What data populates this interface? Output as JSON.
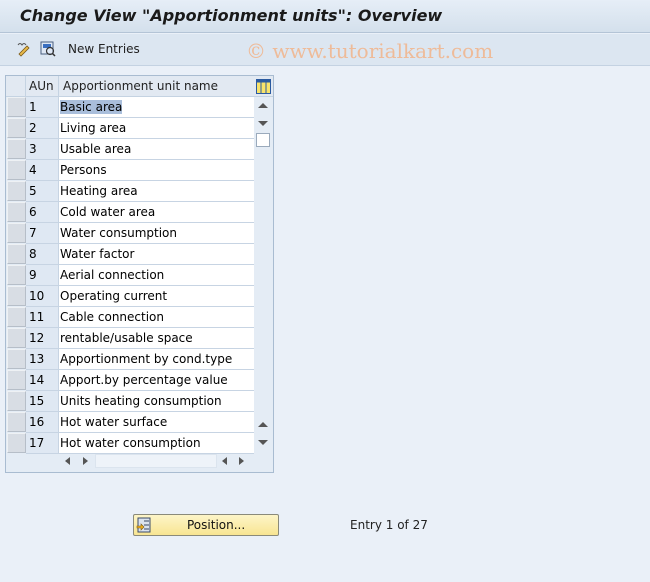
{
  "title": "Change View \"Apportionment units\": Overview",
  "toolbar": {
    "icons": [
      "display-change-icon",
      "select-all-icon"
    ],
    "new_entries_label": "New Entries"
  },
  "watermark": "© www.tutorialkart.com",
  "table": {
    "columns": [
      "AUn",
      "Apportionment unit name"
    ],
    "settings_icon": "table-settings-icon",
    "rows": [
      {
        "key": "1",
        "name": "Basic area",
        "selected": true
      },
      {
        "key": "2",
        "name": "Living area"
      },
      {
        "key": "3",
        "name": "Usable area"
      },
      {
        "key": "4",
        "name": "Persons"
      },
      {
        "key": "5",
        "name": "Heating area"
      },
      {
        "key": "6",
        "name": "Cold water area"
      },
      {
        "key": "7",
        "name": "Water consumption"
      },
      {
        "key": "8",
        "name": "Water factor"
      },
      {
        "key": "9",
        "name": "Aerial connection"
      },
      {
        "key": "10",
        "name": "Operating current"
      },
      {
        "key": "11",
        "name": "Cable connection"
      },
      {
        "key": "12",
        "name": "rentable/usable space"
      },
      {
        "key": "13",
        "name": "Apportionment by cond.type"
      },
      {
        "key": "14",
        "name": "Apport.by percentage value"
      },
      {
        "key": "15",
        "name": "Units heating consumption"
      },
      {
        "key": "16",
        "name": "Hot water surface"
      },
      {
        "key": "17",
        "name": "Hot water consumption"
      }
    ]
  },
  "footer": {
    "position_label": "Position...",
    "entry_text": "Entry 1 of 27"
  }
}
